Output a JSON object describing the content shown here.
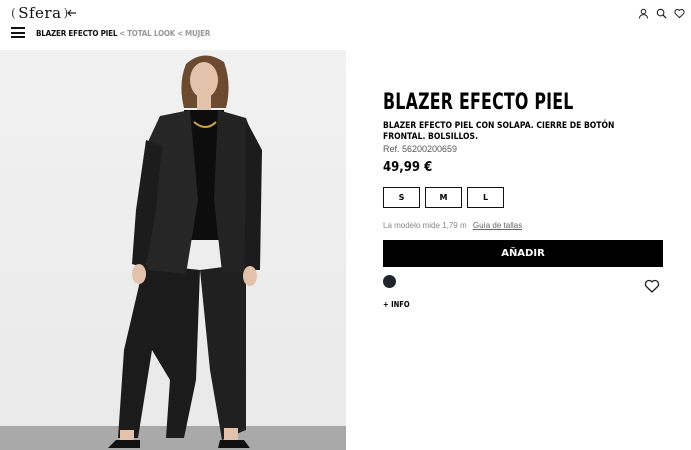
{
  "header": {
    "logo": "Sfera",
    "breadcrumb": {
      "current": "BLAZER EFECTO PIEL",
      "separator": "<",
      "items": [
        "TOTAL LOOK",
        "MUJER"
      ]
    },
    "icons": [
      "user-icon",
      "search-icon",
      "heart-icon"
    ]
  },
  "product": {
    "image_alt": "",
    "title": "BLAZER EFECTO PIEL",
    "description": "BLAZER EFECTO PIEL CON SOLAPA. CIERRE DE BOTÓN FRONTAL. BOLSILLOS.",
    "ref": "Ref. 56200200659",
    "price": "49,99 €",
    "sizes": [
      "S",
      "M",
      "L"
    ],
    "model_info": "La modelo mide 1,79 m",
    "size_guide": "Guía de tallas",
    "add_button": "AÑADIR",
    "color_swatch": "#23232b",
    "more_info": "+ INFO"
  }
}
